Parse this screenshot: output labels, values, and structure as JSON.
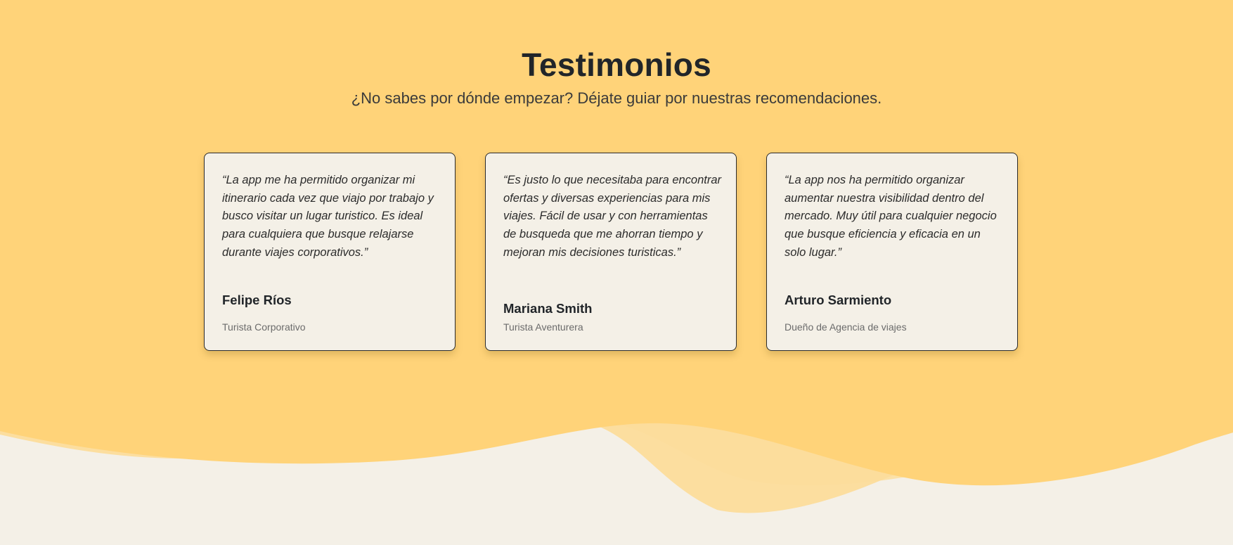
{
  "section": {
    "title": "Testimonios",
    "subtitle": "¿No sabes por dónde empezar? Déjate guiar por nuestras recomendaciones."
  },
  "testimonials": [
    {
      "quote": "“La app me ha permitido organizar mi itinerario cada vez que viajo por trabajo y busco visitar un lugar turistico. Es ideal para cualquiera que busque relajarse durante viajes corporativos.”",
      "name": "Felipe Ríos",
      "role": "Turista Corporativo"
    },
    {
      "quote": "“Es justo lo que necesitaba para encontrar ofertas y diversas experiencias para mis viajes. Fácil de usar y con herramientas de busqueda que me ahorran tiempo y mejoran mis decisiones turisticas.”",
      "name": "Mariana Smith",
      "role": "Turista Aventurera"
    },
    {
      "quote": "“La app nos ha permitido organizar aumentar nuestra visibilidad dentro del mercado. Muy útil para cualquier negocio que busque eficiencia y eficacia en un solo lugar.”",
      "name": "Arturo Sarmiento",
      "role": "Dueño de Agencia de viajes"
    }
  ],
  "colors": {
    "section_background": "#ffd379",
    "page_background": "#f4f0e7",
    "card_background": "#f4f0e7",
    "card_border": "#2b2b2b",
    "heading_text": "#212529",
    "role_text": "#6b6b6b"
  }
}
